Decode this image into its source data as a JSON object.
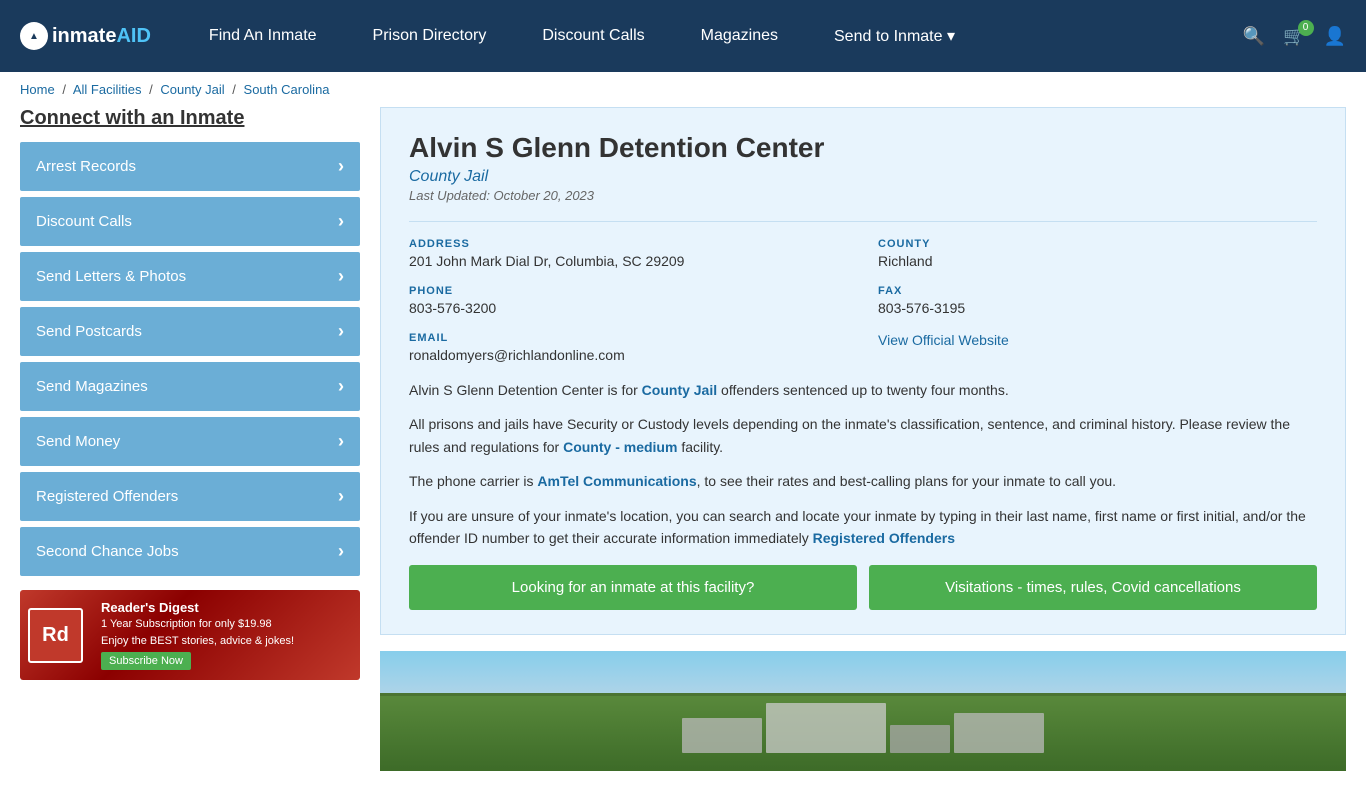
{
  "header": {
    "logo_text": "inmate",
    "logo_aid": "AID",
    "nav": [
      {
        "label": "Find An Inmate",
        "id": "find-an-inmate"
      },
      {
        "label": "Prison Directory",
        "id": "prison-directory"
      },
      {
        "label": "Discount Calls",
        "id": "discount-calls"
      },
      {
        "label": "Magazines",
        "id": "magazines"
      },
      {
        "label": "Send to Inmate ▾",
        "id": "send-to-inmate"
      }
    ],
    "cart_count": "0"
  },
  "breadcrumb": {
    "home": "Home",
    "all_facilities": "All Facilities",
    "county_jail": "County Jail",
    "state": "South Carolina"
  },
  "sidebar": {
    "title": "Connect with an Inmate",
    "items": [
      {
        "label": "Arrest Records"
      },
      {
        "label": "Discount Calls"
      },
      {
        "label": "Send Letters & Photos"
      },
      {
        "label": "Send Postcards"
      },
      {
        "label": "Send Magazines"
      },
      {
        "label": "Send Money"
      },
      {
        "label": "Registered Offenders"
      },
      {
        "label": "Second Chance Jobs"
      }
    ]
  },
  "ad": {
    "logo": "Rd",
    "title": "Reader's Digest",
    "subtitle": "1 Year Subscription for only $19.98",
    "body": "Enjoy the BEST stories, advice & jokes!",
    "button": "Subscribe Now"
  },
  "facility": {
    "name": "Alvin S Glenn Detention Center",
    "type": "County Jail",
    "last_updated": "Last Updated: October 20, 2023",
    "address_label": "ADDRESS",
    "address_value": "201 John Mark Dial Dr, Columbia, SC 29209",
    "county_label": "COUNTY",
    "county_value": "Richland",
    "phone_label": "PHONE",
    "phone_value": "803-576-3200",
    "fax_label": "FAX",
    "fax_value": "803-576-3195",
    "email_label": "EMAIL",
    "email_value": "ronaldomyers@richlandonline.com",
    "website_label": "View Official Website",
    "desc1": "Alvin S Glenn Detention Center is for ",
    "desc1_link": "County Jail",
    "desc1_cont": " offenders sentenced up to twenty four months.",
    "desc2": "All prisons and jails have Security or Custody levels depending on the inmate's classification, sentence, and criminal history. Please review the rules and regulations for ",
    "desc2_link": "County - medium",
    "desc2_cont": " facility.",
    "desc3": "The phone carrier is ",
    "desc3_link": "AmTel Communications",
    "desc3_cont": ", to see their rates and best-calling plans for your inmate to call you.",
    "desc4": "If you are unsure of your inmate's location, you can search and locate your inmate by typing in their last name, first name or first initial, and/or the offender ID number to get their accurate information immediately ",
    "desc4_link": "Registered Offenders",
    "btn1": "Looking for an inmate at this facility?",
    "btn2": "Visitations - times, rules, Covid cancellations"
  }
}
